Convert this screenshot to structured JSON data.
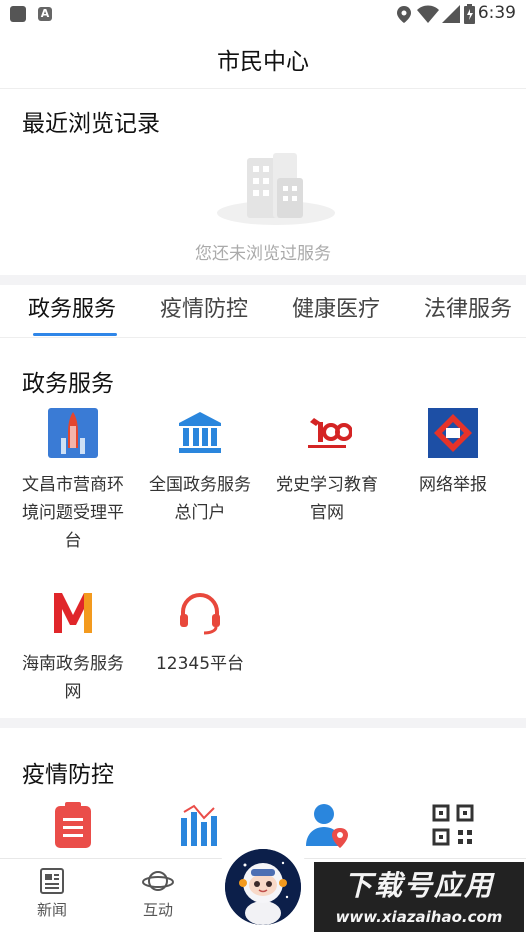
{
  "status_bar": {
    "time": "6:39"
  },
  "header": {
    "title": "市民中心"
  },
  "recent": {
    "title": "最近浏览记录",
    "empty_text": "您还未浏览过服务"
  },
  "tabs": [
    {
      "label": "政务服务",
      "active": true
    },
    {
      "label": "疫情防控"
    },
    {
      "label": "健康医疗"
    },
    {
      "label": "法律服务"
    }
  ],
  "gov_services": {
    "title": "政务服务",
    "items": [
      {
        "label": "文昌市营商环境问题受理平台",
        "icon": "rocket-icon"
      },
      {
        "label": "全国政务服务总门户",
        "icon": "government-building-icon"
      },
      {
        "label": "党史学习教育官网",
        "icon": "party-100-icon"
      },
      {
        "label": "网络举报",
        "icon": "report-logo-icon"
      },
      {
        "label": "海南政务服务网",
        "icon": "hainan-m-logo-icon"
      },
      {
        "label": "12345平台",
        "icon": "headset-icon"
      }
    ]
  },
  "epidemic": {
    "title": "疫情防控",
    "items": [
      {
        "icon": "clipboard-icon"
      },
      {
        "icon": "bar-chart-icon"
      },
      {
        "icon": "user-location-icon"
      },
      {
        "icon": "qr-code-icon"
      }
    ]
  },
  "bottom_nav": [
    {
      "label": "新闻",
      "icon": "news-icon"
    },
    {
      "label": "互动",
      "icon": "planet-icon"
    },
    {
      "label": "",
      "icon": "astronaut-icon"
    }
  ],
  "watermark": {
    "line1": "下载号应用",
    "line2": "www.xiazaihao.com"
  },
  "colors": {
    "accent": "#2f86e8",
    "separator": "#f3f3f5"
  }
}
